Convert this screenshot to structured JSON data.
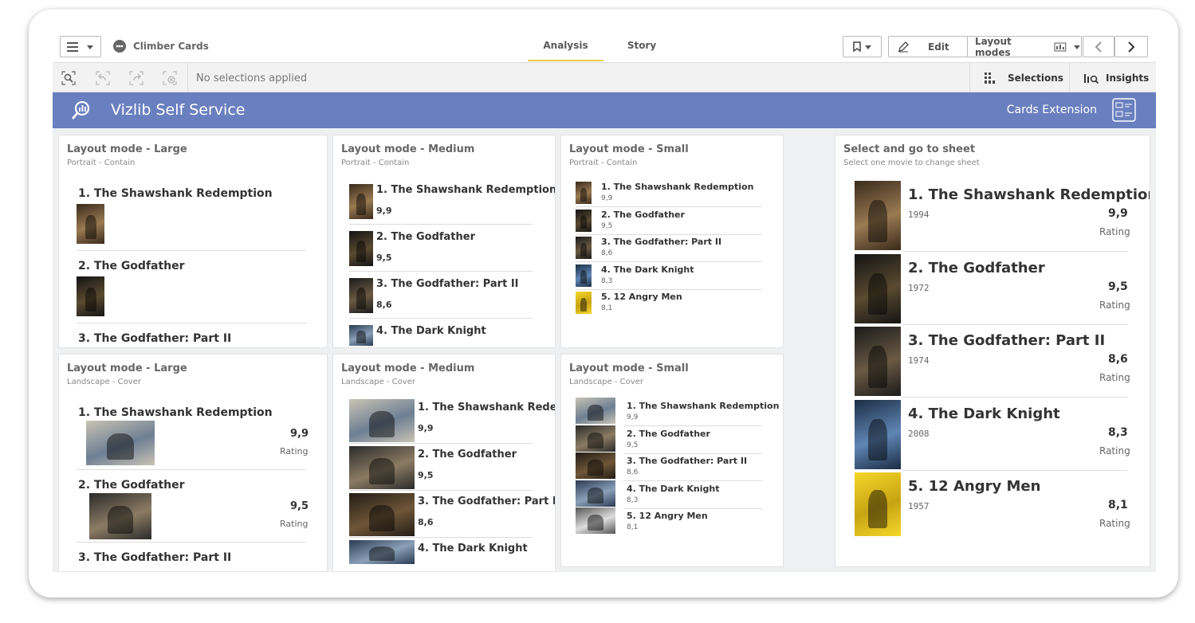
{
  "toolbar": {
    "app_title": "Climber Cards",
    "tabs": [
      "Analysis",
      "Story"
    ],
    "edit_label": "Edit",
    "layout_modes_label": "Layout modes"
  },
  "selections": {
    "no_selections": "No selections applied",
    "selections_label": "Selections",
    "insights_label": "Insights"
  },
  "banner": {
    "title": "Vizlib Self Service",
    "right_label": "Cards Extension"
  },
  "movies": [
    {
      "title": "1. The Shawshank Redemption",
      "rating": "9,9",
      "year": "1994"
    },
    {
      "title": "2. The Godfather",
      "rating": "9,5",
      "year": "1972"
    },
    {
      "title": "3. The Godfather: Part II",
      "rating": "8,6",
      "year": "1974"
    },
    {
      "title": "4. The Dark Knight",
      "rating": "8,3",
      "year": "2008"
    },
    {
      "title": "5. 12 Angry Men",
      "rating": "8,1",
      "year": "1957"
    }
  ],
  "rating_label": "Rating",
  "truncated_title": "1. The Shawshank Rede.",
  "panels": {
    "large_portrait": {
      "title": "Layout mode - Large",
      "subtitle": "Portrait - Contain"
    },
    "medium_portrait": {
      "title": "Layout mode - Medium",
      "subtitle": "Portrait - Contain"
    },
    "small_portrait": {
      "title": "Layout mode - Small",
      "subtitle": "Portrait - Contain"
    },
    "large_landscape": {
      "title": "Layout mode - Large",
      "subtitle": "Landscape - Cover"
    },
    "medium_landscape": {
      "title": "Layout mode - Medium",
      "subtitle": "Landscape - Cover"
    },
    "small_landscape": {
      "title": "Layout mode - Small",
      "subtitle": "Landscape - Cover"
    },
    "select": {
      "title": "Select and go to sheet",
      "subtitle": "Select one movie to change sheet"
    }
  },
  "colors": {
    "banner": "#6a7fbf",
    "canvas": "#eef0f2",
    "active_tab": "#f2c94c",
    "poster_yellow": "#f4d629"
  },
  "icons": [
    "hamburger-icon",
    "app-logo-icon",
    "bookmark-icon",
    "pencil-icon",
    "layout-icon",
    "chevron-left-icon",
    "chevron-right-icon",
    "smart-search-icon",
    "step-back-icon",
    "step-forward-icon",
    "clear-selections-icon",
    "selections-icon",
    "insights-icon",
    "vizlib-logo-icon",
    "cards-extension-icon"
  ]
}
